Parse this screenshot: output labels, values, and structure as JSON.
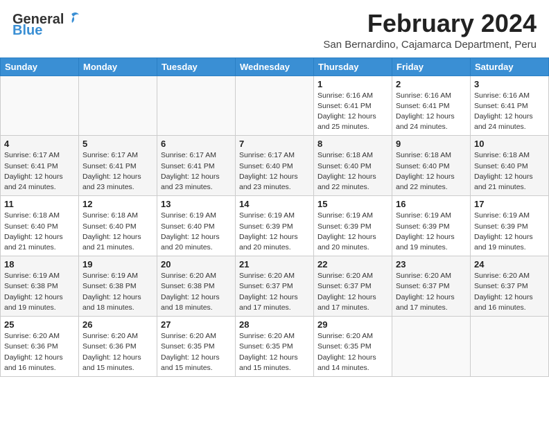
{
  "header": {
    "logo_general": "General",
    "logo_blue": "Blue",
    "month_year": "February 2024",
    "location": "San Bernardino, Cajamarca Department, Peru"
  },
  "days_of_week": [
    "Sunday",
    "Monday",
    "Tuesday",
    "Wednesday",
    "Thursday",
    "Friday",
    "Saturday"
  ],
  "weeks": [
    [
      {
        "day": "",
        "info": ""
      },
      {
        "day": "",
        "info": ""
      },
      {
        "day": "",
        "info": ""
      },
      {
        "day": "",
        "info": ""
      },
      {
        "day": "1",
        "info": "Sunrise: 6:16 AM\nSunset: 6:41 PM\nDaylight: 12 hours\nand 25 minutes."
      },
      {
        "day": "2",
        "info": "Sunrise: 6:16 AM\nSunset: 6:41 PM\nDaylight: 12 hours\nand 24 minutes."
      },
      {
        "day": "3",
        "info": "Sunrise: 6:16 AM\nSunset: 6:41 PM\nDaylight: 12 hours\nand 24 minutes."
      }
    ],
    [
      {
        "day": "4",
        "info": "Sunrise: 6:17 AM\nSunset: 6:41 PM\nDaylight: 12 hours\nand 24 minutes."
      },
      {
        "day": "5",
        "info": "Sunrise: 6:17 AM\nSunset: 6:41 PM\nDaylight: 12 hours\nand 23 minutes."
      },
      {
        "day": "6",
        "info": "Sunrise: 6:17 AM\nSunset: 6:41 PM\nDaylight: 12 hours\nand 23 minutes."
      },
      {
        "day": "7",
        "info": "Sunrise: 6:17 AM\nSunset: 6:40 PM\nDaylight: 12 hours\nand 23 minutes."
      },
      {
        "day": "8",
        "info": "Sunrise: 6:18 AM\nSunset: 6:40 PM\nDaylight: 12 hours\nand 22 minutes."
      },
      {
        "day": "9",
        "info": "Sunrise: 6:18 AM\nSunset: 6:40 PM\nDaylight: 12 hours\nand 22 minutes."
      },
      {
        "day": "10",
        "info": "Sunrise: 6:18 AM\nSunset: 6:40 PM\nDaylight: 12 hours\nand 21 minutes."
      }
    ],
    [
      {
        "day": "11",
        "info": "Sunrise: 6:18 AM\nSunset: 6:40 PM\nDaylight: 12 hours\nand 21 minutes."
      },
      {
        "day": "12",
        "info": "Sunrise: 6:18 AM\nSunset: 6:40 PM\nDaylight: 12 hours\nand 21 minutes."
      },
      {
        "day": "13",
        "info": "Sunrise: 6:19 AM\nSunset: 6:40 PM\nDaylight: 12 hours\nand 20 minutes."
      },
      {
        "day": "14",
        "info": "Sunrise: 6:19 AM\nSunset: 6:39 PM\nDaylight: 12 hours\nand 20 minutes."
      },
      {
        "day": "15",
        "info": "Sunrise: 6:19 AM\nSunset: 6:39 PM\nDaylight: 12 hours\nand 20 minutes."
      },
      {
        "day": "16",
        "info": "Sunrise: 6:19 AM\nSunset: 6:39 PM\nDaylight: 12 hours\nand 19 minutes."
      },
      {
        "day": "17",
        "info": "Sunrise: 6:19 AM\nSunset: 6:39 PM\nDaylight: 12 hours\nand 19 minutes."
      }
    ],
    [
      {
        "day": "18",
        "info": "Sunrise: 6:19 AM\nSunset: 6:38 PM\nDaylight: 12 hours\nand 19 minutes."
      },
      {
        "day": "19",
        "info": "Sunrise: 6:19 AM\nSunset: 6:38 PM\nDaylight: 12 hours\nand 18 minutes."
      },
      {
        "day": "20",
        "info": "Sunrise: 6:20 AM\nSunset: 6:38 PM\nDaylight: 12 hours\nand 18 minutes."
      },
      {
        "day": "21",
        "info": "Sunrise: 6:20 AM\nSunset: 6:37 PM\nDaylight: 12 hours\nand 17 minutes."
      },
      {
        "day": "22",
        "info": "Sunrise: 6:20 AM\nSunset: 6:37 PM\nDaylight: 12 hours\nand 17 minutes."
      },
      {
        "day": "23",
        "info": "Sunrise: 6:20 AM\nSunset: 6:37 PM\nDaylight: 12 hours\nand 17 minutes."
      },
      {
        "day": "24",
        "info": "Sunrise: 6:20 AM\nSunset: 6:37 PM\nDaylight: 12 hours\nand 16 minutes."
      }
    ],
    [
      {
        "day": "25",
        "info": "Sunrise: 6:20 AM\nSunset: 6:36 PM\nDaylight: 12 hours\nand 16 minutes."
      },
      {
        "day": "26",
        "info": "Sunrise: 6:20 AM\nSunset: 6:36 PM\nDaylight: 12 hours\nand 15 minutes."
      },
      {
        "day": "27",
        "info": "Sunrise: 6:20 AM\nSunset: 6:35 PM\nDaylight: 12 hours\nand 15 minutes."
      },
      {
        "day": "28",
        "info": "Sunrise: 6:20 AM\nSunset: 6:35 PM\nDaylight: 12 hours\nand 15 minutes."
      },
      {
        "day": "29",
        "info": "Sunrise: 6:20 AM\nSunset: 6:35 PM\nDaylight: 12 hours\nand 14 minutes."
      },
      {
        "day": "",
        "info": ""
      },
      {
        "day": "",
        "info": ""
      }
    ]
  ]
}
